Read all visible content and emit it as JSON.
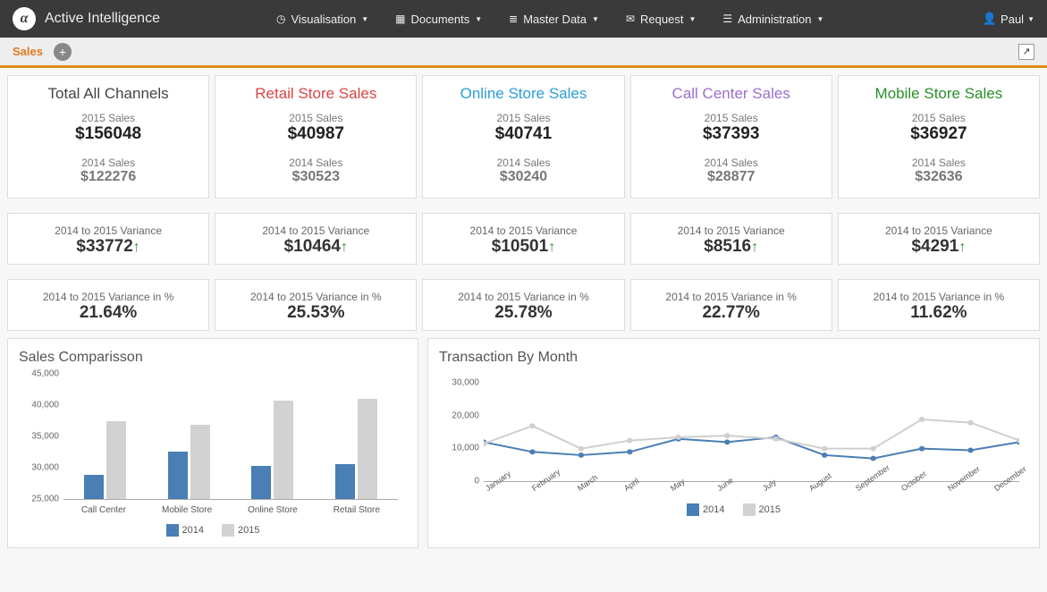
{
  "brand": "Active Intelligence",
  "nav": [
    {
      "icon": "◷",
      "label": "Visualisation"
    },
    {
      "icon": "▦",
      "label": "Documents"
    },
    {
      "icon": "≣",
      "label": "Master Data"
    },
    {
      "icon": "✉",
      "label": "Request"
    },
    {
      "icon": "☰",
      "label": "Administration"
    }
  ],
  "user": "Paul",
  "tab": "Sales",
  "cards": [
    {
      "title": "Total All Channels",
      "cls": "t-total",
      "sales_label": "2015 Sales",
      "sales_val": "$156048",
      "prev_label": "2014 Sales",
      "prev_val": "$122276",
      "var_label": "2014 to 2015 Variance",
      "var_val": "$33772",
      "pct_label": "2014 to 2015 Variance in %",
      "pct_val": "21.64%"
    },
    {
      "title": "Retail Store Sales",
      "cls": "t-retail",
      "sales_label": "2015 Sales",
      "sales_val": "$40987",
      "prev_label": "2014 Sales",
      "prev_val": "$30523",
      "var_label": "2014 to 2015 Variance",
      "var_val": "$10464",
      "pct_label": "2014 to 2015 Variance in %",
      "pct_val": "25.53%"
    },
    {
      "title": "Online Store Sales",
      "cls": "t-online",
      "sales_label": "2015 Sales",
      "sales_val": "$40741",
      "prev_label": "2014 Sales",
      "prev_val": "$30240",
      "var_label": "2014 to 2015 Variance",
      "var_val": "$10501",
      "pct_label": "2014 to 2015 Variance in %",
      "pct_val": "25.78%"
    },
    {
      "title": "Call Center Sales",
      "cls": "t-call",
      "sales_label": "2015 Sales",
      "sales_val": "$37393",
      "prev_label": "2014 Sales",
      "prev_val": "$28877",
      "var_label": "2014 to 2015 Variance",
      "var_val": "$8516",
      "pct_label": "2014 to 2015 Variance in %",
      "pct_val": "22.77%"
    },
    {
      "title": "Mobile Store Sales",
      "cls": "t-mobile",
      "sales_label": "2015 Sales",
      "sales_val": "$36927",
      "prev_label": "2014 Sales",
      "prev_val": "$32636",
      "var_label": "2014 to 2015 Variance",
      "var_val": "$4291",
      "pct_label": "2014 to 2015 Variance in %",
      "pct_val": "11.62%"
    }
  ],
  "chart1": {
    "title": "Sales Comparisson",
    "legend": [
      "2014",
      "2015"
    ]
  },
  "chart2": {
    "title": "Transaction By Month",
    "legend": [
      "2014",
      "2015"
    ]
  },
  "chart_data": [
    {
      "type": "bar",
      "title": "Sales Comparisson",
      "categories": [
        "Call Center",
        "Mobile Store",
        "Online Store",
        "Retail Store"
      ],
      "series": [
        {
          "name": "2014",
          "values": [
            28877,
            32636,
            30240,
            30523
          ]
        },
        {
          "name": "2015",
          "values": [
            37393,
            36927,
            40741,
            40987
          ]
        }
      ],
      "ylim": [
        25000,
        45000
      ],
      "yticks": [
        25000,
        30000,
        35000,
        40000,
        45000
      ]
    },
    {
      "type": "line",
      "title": "Transaction By Month",
      "categories": [
        "January",
        "February",
        "March",
        "April",
        "May",
        "June",
        "July",
        "August",
        "September",
        "October",
        "November",
        "December"
      ],
      "series": [
        {
          "name": "2014",
          "values": [
            12000,
            9000,
            8000,
            9000,
            13000,
            12000,
            13500,
            8000,
            7000,
            10000,
            9500,
            12000
          ]
        },
        {
          "name": "2015",
          "values": [
            11500,
            17000,
            10000,
            12500,
            13500,
            14000,
            13000,
            10000,
            10000,
            19000,
            18000,
            12500
          ]
        }
      ],
      "ylim": [
        0,
        30000
      ],
      "yticks": [
        0,
        10000,
        20000,
        30000
      ]
    }
  ]
}
